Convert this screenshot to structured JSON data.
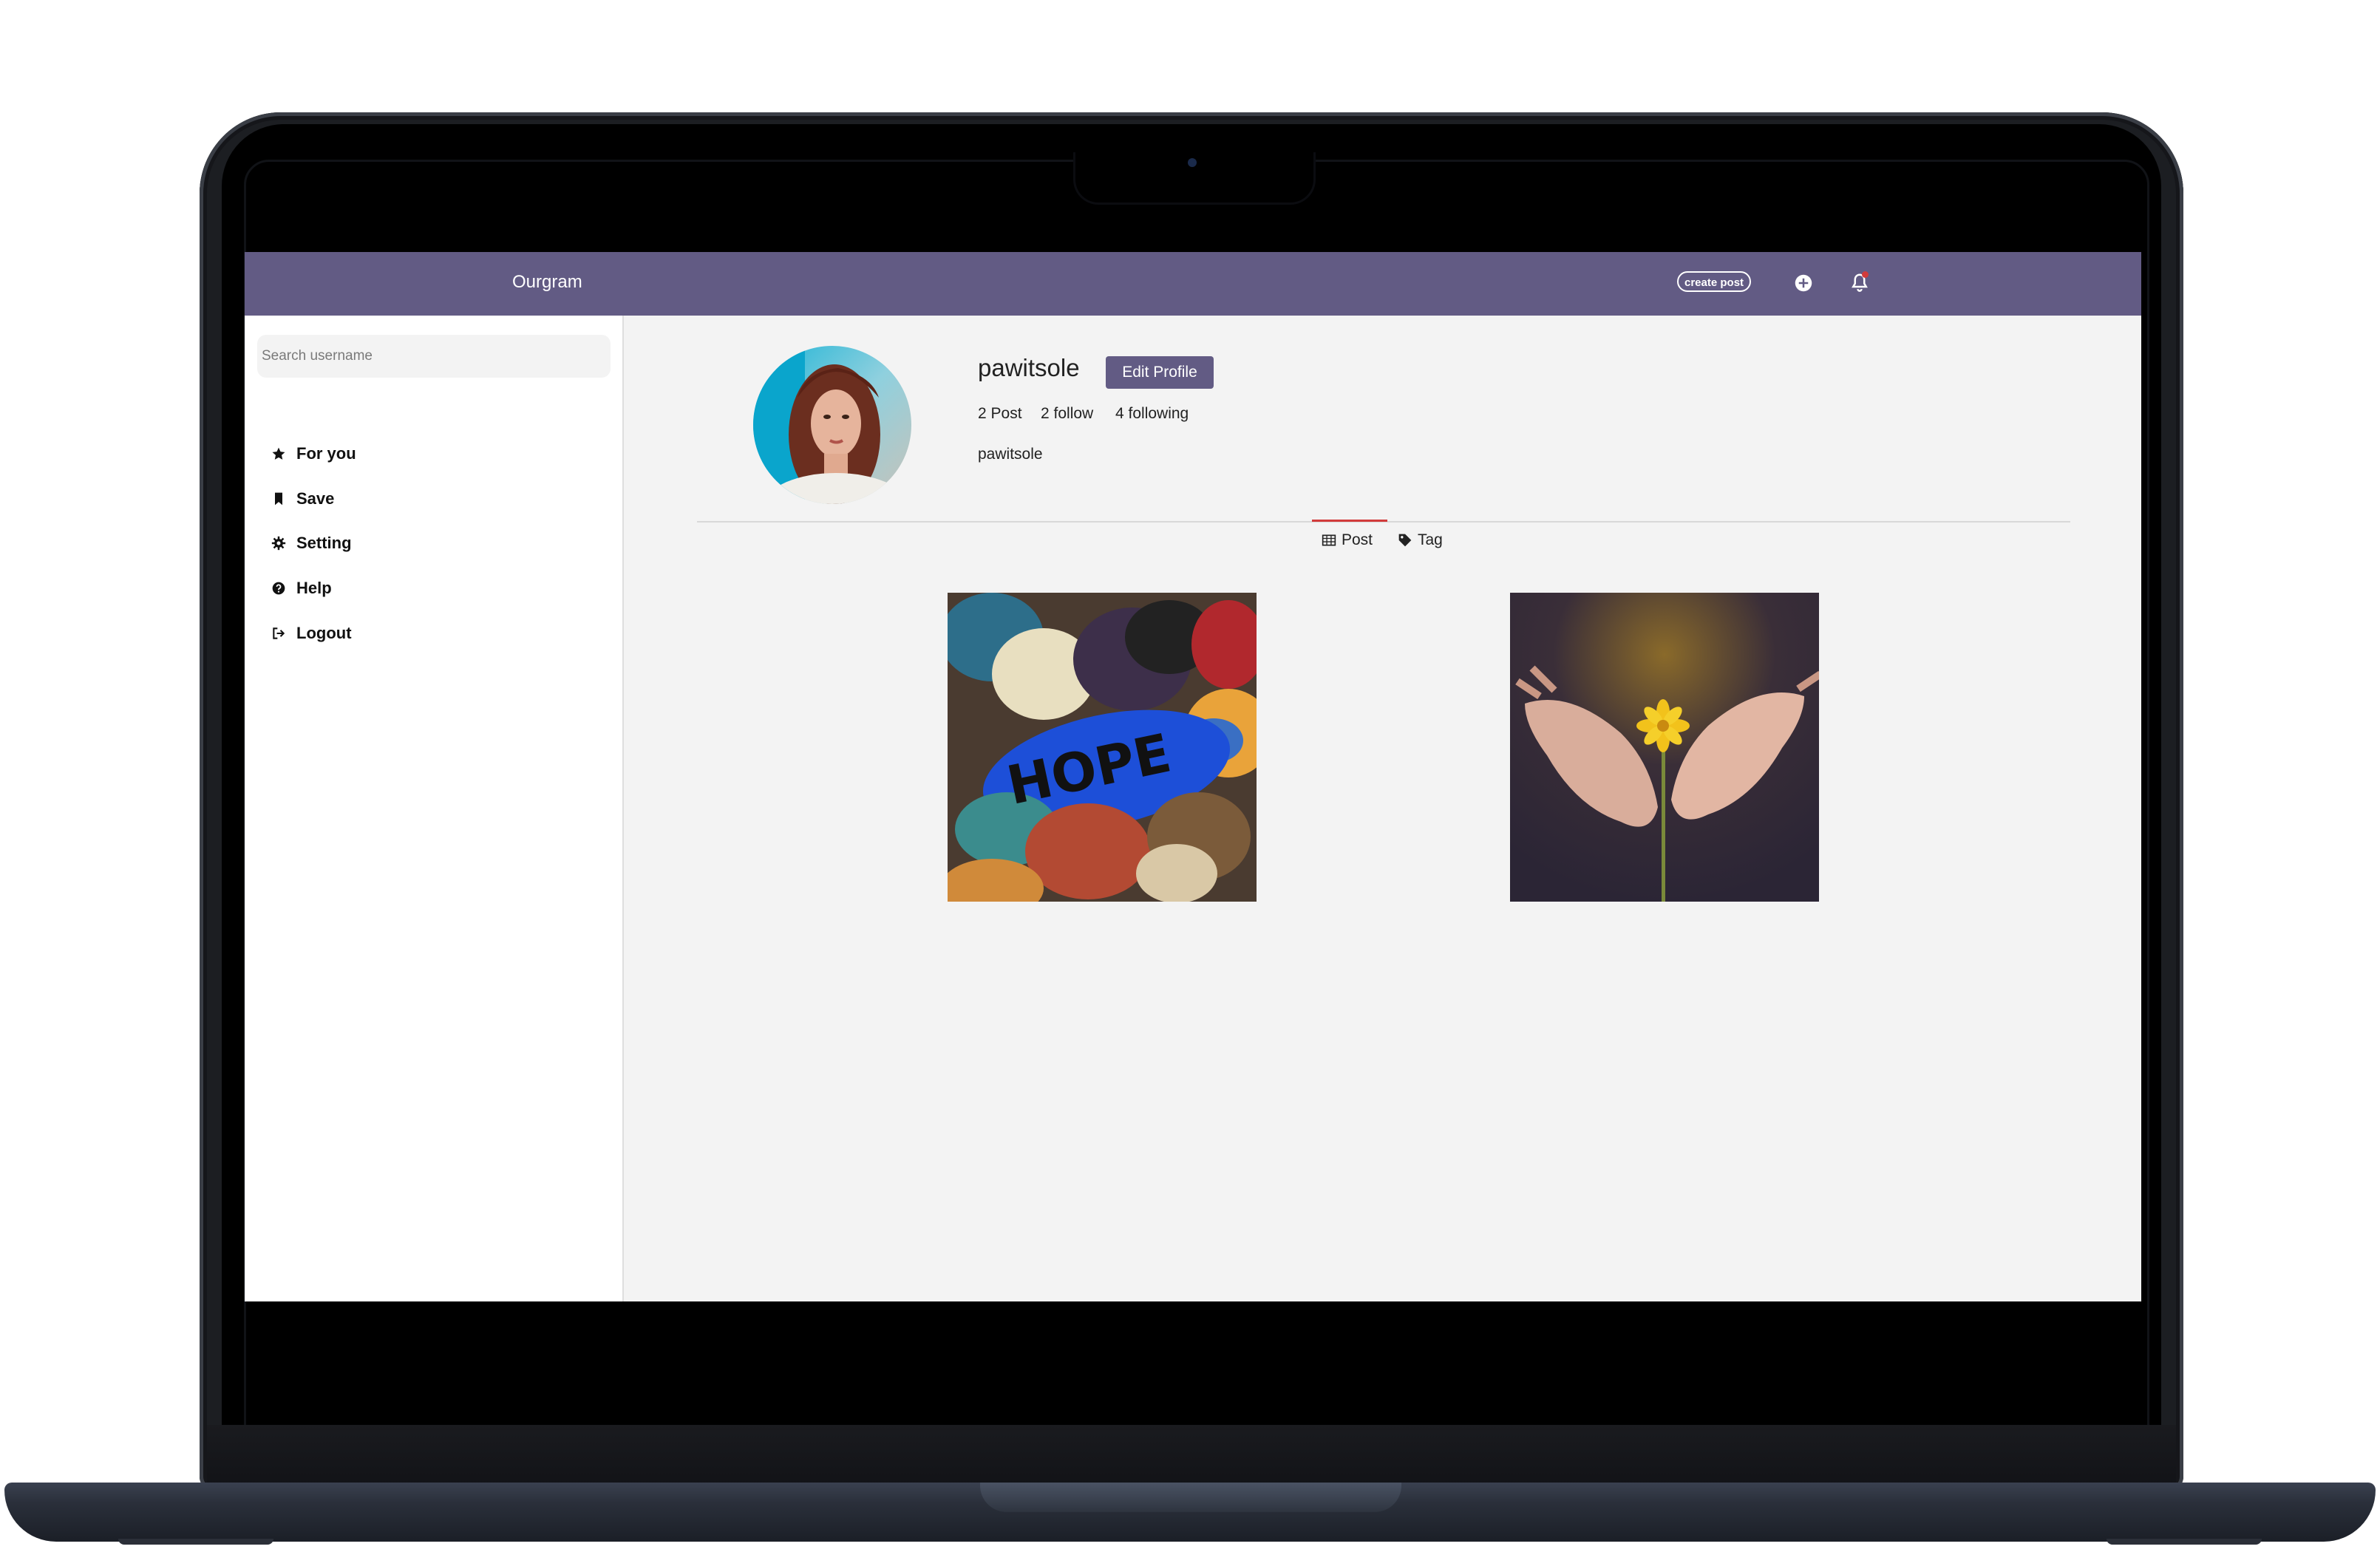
{
  "navbar": {
    "brand": "Ourgram",
    "create_post_label": "create post",
    "icons": [
      "plus-circle-icon",
      "bell-icon"
    ],
    "accent_color": "#625b84"
  },
  "sidebar": {
    "search_placeholder": "Search username",
    "items": [
      {
        "label": "For you",
        "icon": "star-icon"
      },
      {
        "label": "Save",
        "icon": "bookmark-icon"
      },
      {
        "label": "Setting",
        "icon": "gear-icon"
      },
      {
        "label": "Help",
        "icon": "question-circle-icon"
      },
      {
        "label": "Logout",
        "icon": "logout-icon"
      }
    ]
  },
  "profile": {
    "username": "pawitsole",
    "edit_label": "Edit Profile",
    "stats": {
      "posts": "2 Post",
      "follow": "2 follow",
      "following": "4 following"
    },
    "display_name": "pawitsole"
  },
  "tabs": [
    {
      "label": "Post",
      "icon": "table-grid-icon",
      "active": true
    },
    {
      "label": "Tag",
      "icon": "tag-icon",
      "active": false
    }
  ],
  "posts": [
    {
      "image": "painted-hope-stones-photo"
    },
    {
      "image": "hands-holding-yellow-flower-photo"
    }
  ]
}
